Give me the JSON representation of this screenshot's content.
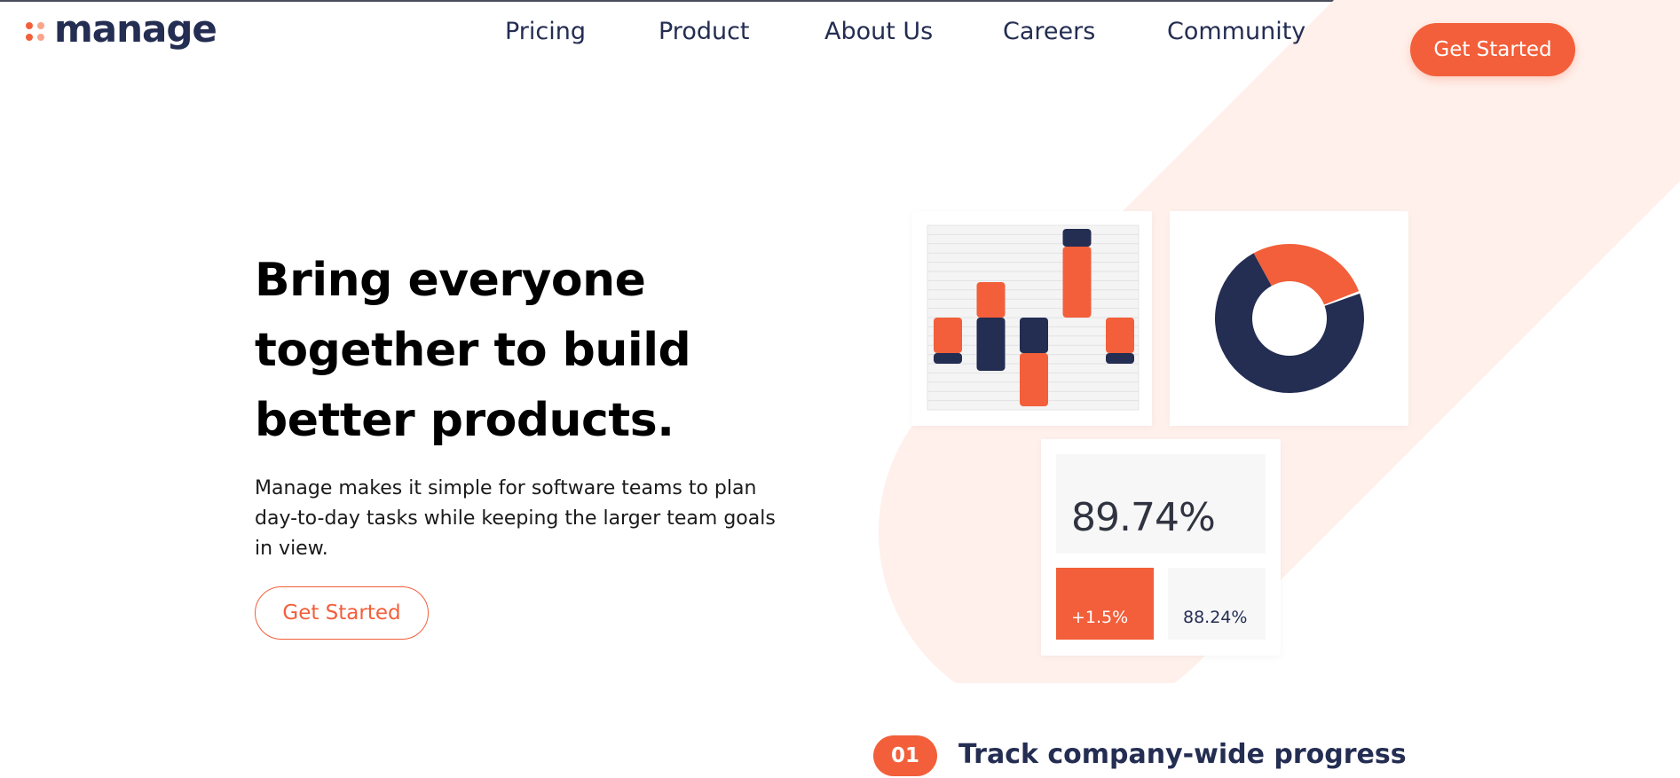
{
  "brand": {
    "name": "manage",
    "accent_color": "#f25f3a",
    "dark_color": "#242d52",
    "tint_color": "#fff0eb"
  },
  "nav": {
    "items": [
      "Pricing",
      "Product",
      "About Us",
      "Careers",
      "Community"
    ],
    "cta_label": "Get Started"
  },
  "hero": {
    "title_lines": [
      "Bring everyone",
      "together to build",
      "better products."
    ],
    "description_lines": [
      "Manage makes it simple for software teams to plan",
      "day-to-day tasks while keeping the larger team goals",
      "in view."
    ],
    "cta_label": "Get Started"
  },
  "illustration": {
    "bar_chart": {
      "bars": [
        {
          "orange": [
            0,
            -1.0
          ],
          "navy": [
            -1.0,
            -1.3
          ]
        },
        {
          "orange": [
            1.0,
            0
          ],
          "navy": [
            0,
            -1.5
          ]
        },
        {
          "orange": [
            -1.0,
            -2.5
          ],
          "navy": [
            0,
            -1.0
          ]
        },
        {
          "orange": [
            2.0,
            0
          ],
          "navy": [
            2.5,
            2.0
          ]
        },
        {
          "orange": [
            0,
            -1.0
          ],
          "navy": [
            -1.0,
            -1.3
          ]
        }
      ]
    },
    "donut": {
      "orange_fraction": 0.27,
      "colors": [
        "#f25f3a",
        "#242d52"
      ]
    },
    "stats": {
      "main_value": "89.74%",
      "change_value": "+1.5%",
      "secondary_value": "88.24%"
    }
  },
  "features": [
    {
      "number": "01",
      "title": "Track company-wide progress"
    }
  ]
}
